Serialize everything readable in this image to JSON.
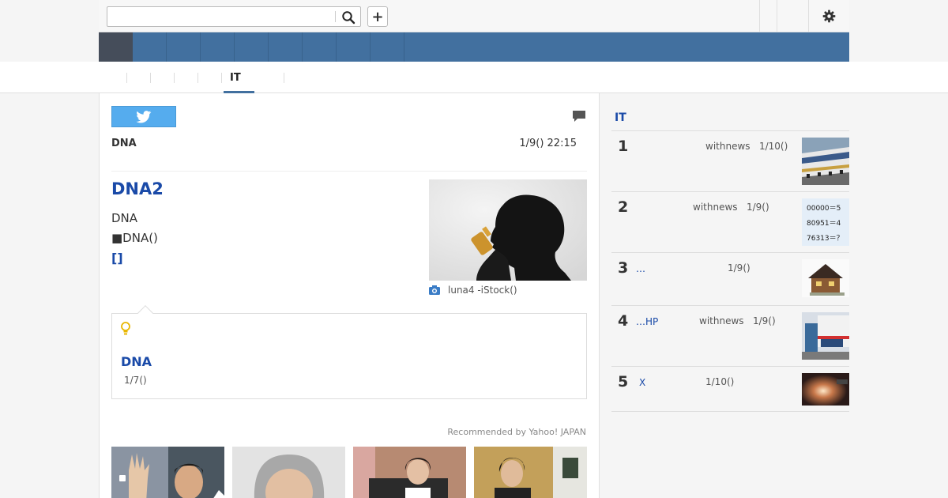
{
  "search": {
    "value": "",
    "placeholder": ""
  },
  "toolbar": {
    "add_label": "+"
  },
  "nav_tabs": [
    "",
    "",
    "",
    "",
    "",
    "IT",
    ""
  ],
  "article": {
    "source": "DNA",
    "date": "1/9() 22:15",
    "headline": "DNA2",
    "summary_line1": "DNA",
    "summary_line2": "■DNA()",
    "more_link": "[]",
    "photo_credit": "luna4 -iStock()",
    "insight_title": "DNA",
    "insight_date": "1/7()"
  },
  "recommended": {
    "label": "Recommended by Yahoo! JAPAN"
  },
  "ranking": {
    "title": "IT",
    "items": [
      {
        "num": "1",
        "title": "",
        "source": "withnews",
        "date": "1/10()"
      },
      {
        "num": "2",
        "title": "",
        "source": "withnews",
        "date": "1/9()",
        "image_lines": [
          "00000＝5",
          "80951＝4",
          "76313＝？"
        ]
      },
      {
        "num": "3",
        "title": "…",
        "source": "",
        "date": "1/9()"
      },
      {
        "num": "4",
        "title": "…HP",
        "source": "withnews",
        "date": "1/9()"
      },
      {
        "num": "5",
        "title": "X",
        "source": "",
        "date": "1/10()"
      }
    ]
  },
  "colors": {
    "brand_blue": "#42709f",
    "link_blue": "#1a4aa8",
    "twitter": "#55acee"
  }
}
